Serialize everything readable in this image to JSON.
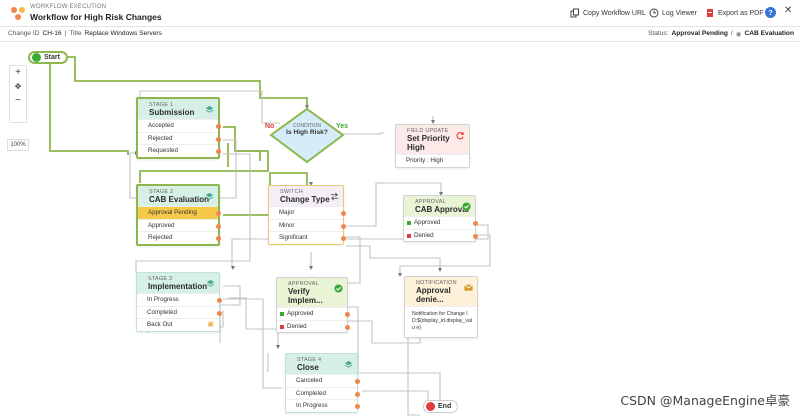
{
  "header": {
    "subtitle": "WORKFLOW EXECUTION",
    "title": "Workflow for High Risk Changes",
    "copy_url": "Copy Workflow URL",
    "log_viewer": "Log Viewer",
    "export_pdf": "Export as PDF",
    "help": "?",
    "close": "✕"
  },
  "info": {
    "change_id_label": "Change ID",
    "change_id": "CH-16",
    "sep": "|",
    "title_label": "Title",
    "title": "Replace Windows Servers",
    "status_label": "Status:",
    "status": "Approval Pending",
    "status_sep": "/",
    "stage": "CAB Evaluation"
  },
  "canvas": {
    "zoom": "100%"
  },
  "nodes": {
    "start": "Start",
    "end": "End",
    "stage1": {
      "kind": "STAGE 1",
      "title": "Submission",
      "rows": [
        "Accepted",
        "Rejected",
        "Requested"
      ]
    },
    "condition": {
      "kind": "CONDITION",
      "title": "Is High Risk?",
      "no": "No",
      "yes": "Yes"
    },
    "field": {
      "kind": "FIELD UPDATE",
      "title": "Set Priority High",
      "rows": [
        "Priority : High"
      ]
    },
    "stage2": {
      "kind": "STAGE 2",
      "title": "CAB Evaluation",
      "rows": [
        "Approval Pending",
        "Approved",
        "Rejected"
      ]
    },
    "switch": {
      "kind": "SWITCH",
      "title": "Change Type",
      "rows": [
        "Major",
        "Minor",
        "Significant"
      ]
    },
    "cab": {
      "kind": "APPROVAL",
      "title": "CAB Approval",
      "rows": [
        "Approved",
        "Denied"
      ]
    },
    "stage3": {
      "kind": "STAGE 3",
      "title": "Implementation",
      "rows": [
        "In Progress",
        "Completed",
        "Back Out"
      ]
    },
    "verify": {
      "kind": "APPROVAL",
      "title": "Verify Implem...",
      "rows": [
        "Approved",
        "Denied"
      ]
    },
    "notif": {
      "kind": "NOTIFICATION",
      "title": "Approval denie...",
      "body": "Notification for Change ID:${display_id.display_valu e}"
    },
    "stage4": {
      "kind": "STAGE 4",
      "title": "Close",
      "rows": [
        "Canceled",
        "Completed",
        "In Progress"
      ]
    }
  },
  "watermark": "CSDN @ManageEngine卓豪",
  "colors": {
    "stage_header": "#d7f0e6",
    "wire_green": "#8db64e",
    "wire_gray": "#bdbdbd",
    "port": "#f0874a",
    "pending": "#f7c948",
    "approved": "#3aaa35",
    "denied": "#e23b3b"
  }
}
